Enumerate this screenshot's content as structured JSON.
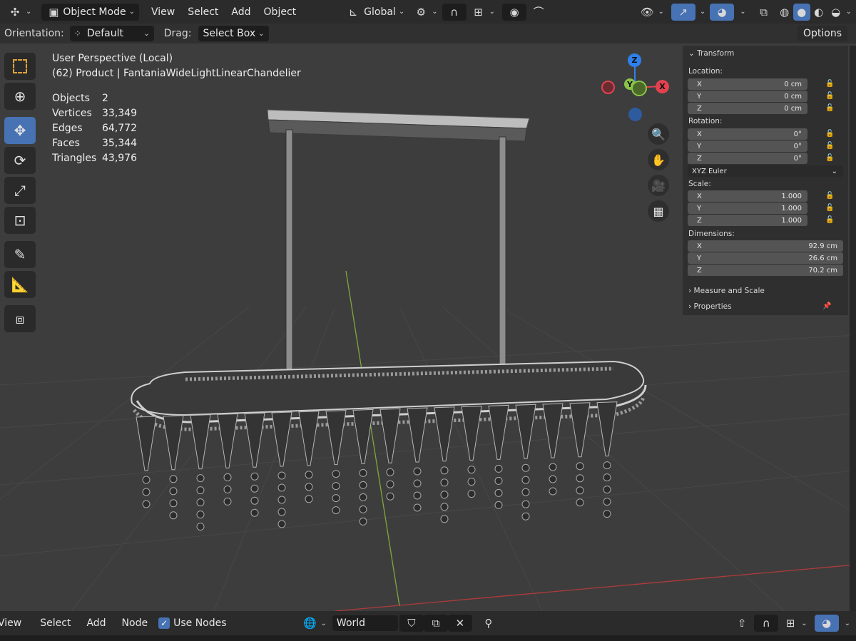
{
  "header": {
    "editor_type_icon": "axis-editor-icon",
    "mode_label": "Object Mode",
    "menus": [
      "View",
      "Select",
      "Add",
      "Object"
    ],
    "transform_orientation": "Global"
  },
  "tool_settings": {
    "orientation_label": "Orientation:",
    "orientation_value": "Default",
    "drag_label": "Drag:",
    "drag_value": "Select Box",
    "options_label": "Options"
  },
  "overlay": {
    "view_name": "User Perspective (Local)",
    "object_line": "(62) Product | FantaniaWideLightLinearChandelier",
    "stats": [
      {
        "label": "Objects",
        "value": "2"
      },
      {
        "label": "Vertices",
        "value": "33,349"
      },
      {
        "label": "Edges",
        "value": "64,772"
      },
      {
        "label": "Faces",
        "value": "35,344"
      },
      {
        "label": "Triangles",
        "value": "43,976"
      }
    ]
  },
  "gizmo": {
    "z": "Z",
    "y": "Y",
    "x": "X"
  },
  "npanel": {
    "transform_title": "Transform",
    "location_label": "Location:",
    "location": [
      {
        "axis": "X",
        "value": "0 cm"
      },
      {
        "axis": "Y",
        "value": "0 cm"
      },
      {
        "axis": "Z",
        "value": "0 cm"
      }
    ],
    "rotation_label": "Rotation:",
    "rotation": [
      {
        "axis": "X",
        "value": "0°"
      },
      {
        "axis": "Y",
        "value": "0°"
      },
      {
        "axis": "Z",
        "value": "0°"
      }
    ],
    "rotation_mode": "XYZ Euler",
    "scale_label": "Scale:",
    "scale": [
      {
        "axis": "X",
        "value": "1.000"
      },
      {
        "axis": "Y",
        "value": "1.000"
      },
      {
        "axis": "Z",
        "value": "1.000"
      }
    ],
    "dimensions_label": "Dimensions:",
    "dimensions": [
      {
        "axis": "X",
        "value": "92.9 cm"
      },
      {
        "axis": "Y",
        "value": "26.6 cm"
      },
      {
        "axis": "Z",
        "value": "70.2 cm"
      }
    ],
    "measure_title": "Measure and Scale",
    "properties_title": "Properties"
  },
  "bottom": {
    "menus": [
      "View",
      "Select",
      "Add",
      "Node"
    ],
    "use_nodes_label": "Use Nodes",
    "use_nodes_checked": true,
    "world_name": "World"
  },
  "colors": {
    "accent": "#4772b3",
    "axis_x": "#e2424f",
    "axis_y": "#8bc34a",
    "axis_z": "#2f80ed"
  }
}
